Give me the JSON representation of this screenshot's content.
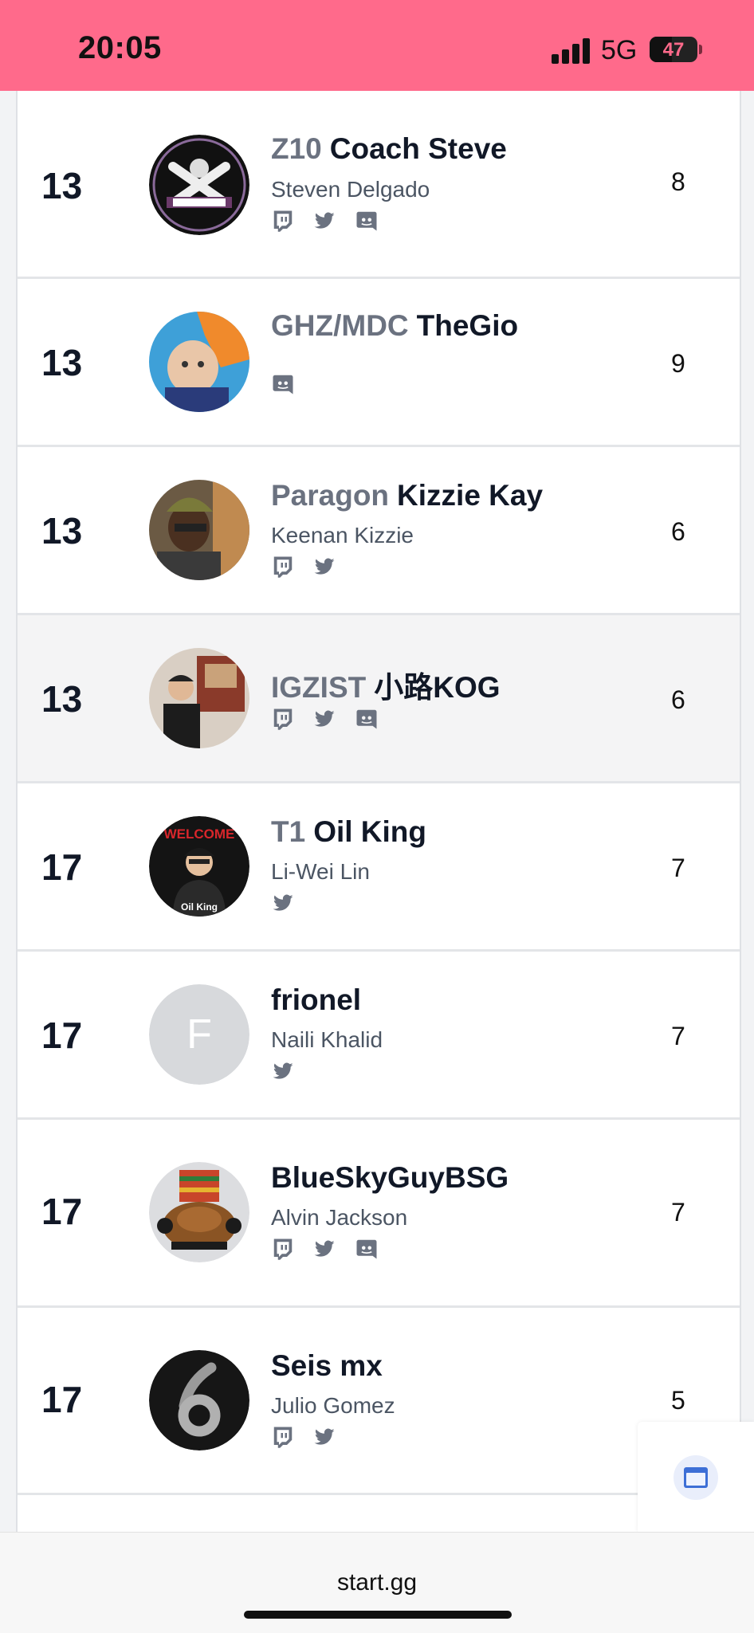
{
  "status_bar": {
    "time": "20:05",
    "network": "5G",
    "battery_level": "47",
    "battery_fraction": 0.47
  },
  "colors": {
    "status_bar_bg": "#ff6a8b",
    "prefix_gray": "#6b7280",
    "highlight_row": "#f4f4f5",
    "social_icon": "#6b7280"
  },
  "rows": [
    {
      "rank": "13",
      "prefix": "Z10",
      "gamer_tag": "Coach Steve",
      "real_name": "Steven Delgado",
      "score": "8",
      "highlighted": false,
      "socials": [
        "twitch-icon",
        "twitter-icon",
        "discord-icon"
      ],
      "avatar": "fight-forever-logo"
    },
    {
      "rank": "13",
      "prefix": "GHZ/MDC",
      "gamer_tag": "TheGio",
      "real_name": "",
      "score": "9",
      "highlighted": false,
      "socials": [
        "discord-icon"
      ],
      "avatar": "photo-child"
    },
    {
      "rank": "13",
      "prefix": "Paragon",
      "gamer_tag": "Kizzie Kay",
      "real_name": "Keenan Kizzie",
      "score": "6",
      "highlighted": false,
      "socials": [
        "twitch-icon",
        "twitter-icon"
      ],
      "avatar": "photo-person"
    },
    {
      "rank": "13",
      "prefix": "IGZIST",
      "gamer_tag": "小路KOG",
      "real_name": "",
      "score": "6",
      "highlighted": true,
      "socials": [
        "twitch-icon",
        "twitter-icon",
        "discord-icon"
      ],
      "avatar": "photo-person-indoor"
    },
    {
      "rank": "17",
      "prefix": "T1",
      "gamer_tag": "Oil King",
      "real_name": "Li-Wei Lin",
      "score": "7",
      "highlighted": false,
      "socials": [
        "twitter-icon"
      ],
      "avatar": "welcome-oil-king",
      "avatar_texts": [
        "WELCOME",
        "Oil King"
      ]
    },
    {
      "rank": "17",
      "prefix": "",
      "gamer_tag": "frionel",
      "real_name": "Naili Khalid",
      "score": "7",
      "highlighted": false,
      "socials": [
        "twitter-icon"
      ],
      "avatar": "letter",
      "avatar_letter": "F"
    },
    {
      "rank": "17",
      "prefix": "",
      "gamer_tag": "BlueSkyGuyBSG",
      "real_name": "Alvin Jackson",
      "score": "7",
      "highlighted": false,
      "socials": [
        "twitch-icon",
        "twitter-icon",
        "discord-icon"
      ],
      "avatar": "character-illustration"
    },
    {
      "rank": "17",
      "prefix": "",
      "gamer_tag": "Seis mx",
      "real_name": "Julio Gomez",
      "score": "5",
      "highlighted": false,
      "socials": [
        "twitch-icon",
        "twitter-icon"
      ],
      "avatar": "number-six-logo"
    }
  ],
  "floating_button": {
    "icon": "browser-window-icon"
  },
  "url_bar": {
    "url": "start.gg"
  }
}
